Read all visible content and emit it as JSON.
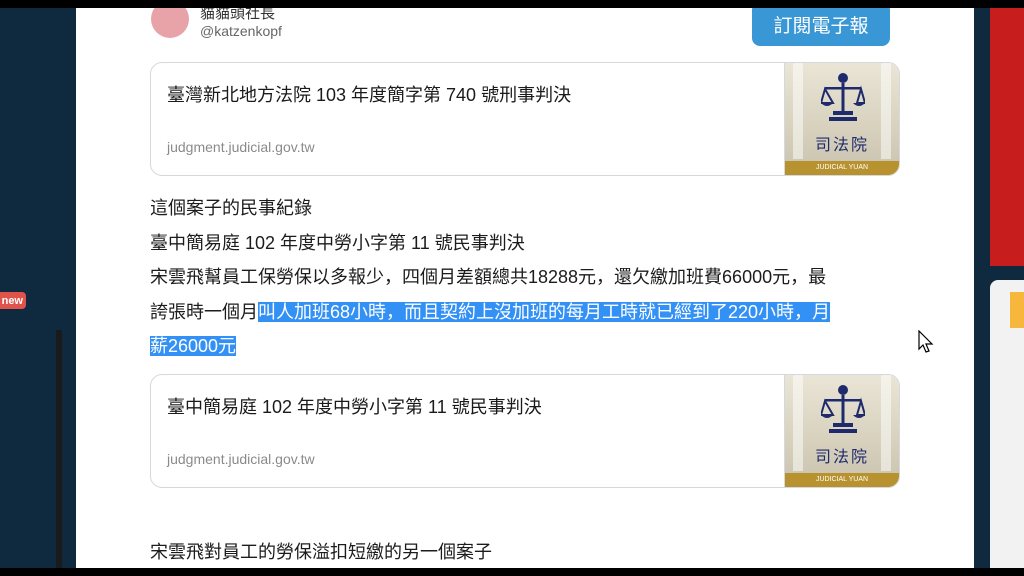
{
  "author": {
    "name": "貓貓頭社長",
    "handle": "@katzenkopf"
  },
  "subscribe_label": "訂閱電子報",
  "new_badge": "new",
  "cards": [
    {
      "title": "臺灣新北地方法院 103 年度簡字第 740 號刑事判決",
      "domain": "judgment.judicial.gov.tw",
      "thumb_label": "司法院",
      "thumb_sub": "JUDICIAL YUAN"
    },
    {
      "title": "臺中簡易庭 102 年度中勞小字第 11 號民事判決",
      "domain": "judgment.judicial.gov.tw",
      "thumb_label": "司法院",
      "thumb_sub": "JUDICIAL YUAN"
    }
  ],
  "paragraphs": {
    "line1": "這個案子的民事紀錄",
    "line2": "臺中簡易庭 102 年度中勞小字第 11 號民事判決",
    "line3": "宋雲飛幫員工保勞保以多報少，四個月差額總共18288元，還欠繳加班費66000元，最",
    "line4_plain": "誇張時一個月",
    "line4_highlight": "叫人加班68小時，而且契約上沒加班的每月工時就已經到了220小時，月",
    "line5_highlight": "薪26000元",
    "line6": "宋雲飛對員工的勞保溢扣短繳的另一個案子"
  },
  "colors": {
    "highlight": "#3390f5",
    "subscribe": "#3a97d6",
    "accent_red": "#c81d1d"
  }
}
